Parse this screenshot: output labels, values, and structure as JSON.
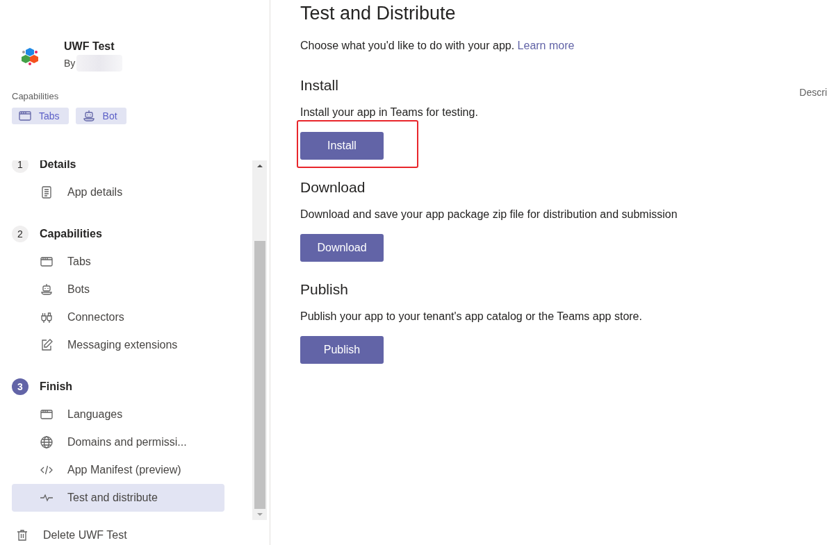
{
  "app": {
    "name": "UWF Test",
    "by": "By"
  },
  "capabilities": {
    "label": "Capabilities",
    "chips": [
      {
        "label": "Tabs",
        "kind": "tabs"
      },
      {
        "label": "Bot",
        "kind": "bot"
      }
    ]
  },
  "steps": [
    {
      "number": "1",
      "title": "Details",
      "current": false,
      "items": [
        {
          "label": "App details",
          "kind": "document",
          "selected": false
        }
      ]
    },
    {
      "number": "2",
      "title": "Capabilities",
      "current": false,
      "items": [
        {
          "label": "Tabs",
          "kind": "tabs",
          "selected": false
        },
        {
          "label": "Bots",
          "kind": "bot",
          "selected": false
        },
        {
          "label": "Connectors",
          "kind": "plug",
          "selected": false
        },
        {
          "label": "Messaging extensions",
          "kind": "edit",
          "selected": false
        }
      ]
    },
    {
      "number": "3",
      "title": "Finish",
      "current": true,
      "items": [
        {
          "label": "Languages",
          "kind": "tabs",
          "selected": false
        },
        {
          "label": "Domains and permissi...",
          "kind": "globe",
          "selected": false
        },
        {
          "label": "App Manifest (preview)",
          "kind": "code",
          "selected": false
        },
        {
          "label": "Test and distribute",
          "kind": "pulse",
          "selected": true
        }
      ]
    }
  ],
  "delete": "Delete UWF Test",
  "main": {
    "title": "Test and Distribute",
    "intro": "Choose what you'd like to do with your app.",
    "link": "Learn more",
    "side_label": "Descri",
    "sections": [
      {
        "heading": "Install",
        "text": "Install your app in Teams for testing.",
        "button": "Install",
        "highlighted": true
      },
      {
        "heading": "Download",
        "text": "Download and save your app package zip file for distribution and submission",
        "button": "Download",
        "highlighted": false
      },
      {
        "heading": "Publish",
        "text": "Publish your app to your tenant's app catalog or the Teams app store.",
        "button": "Publish",
        "highlighted": false
      }
    ]
  }
}
